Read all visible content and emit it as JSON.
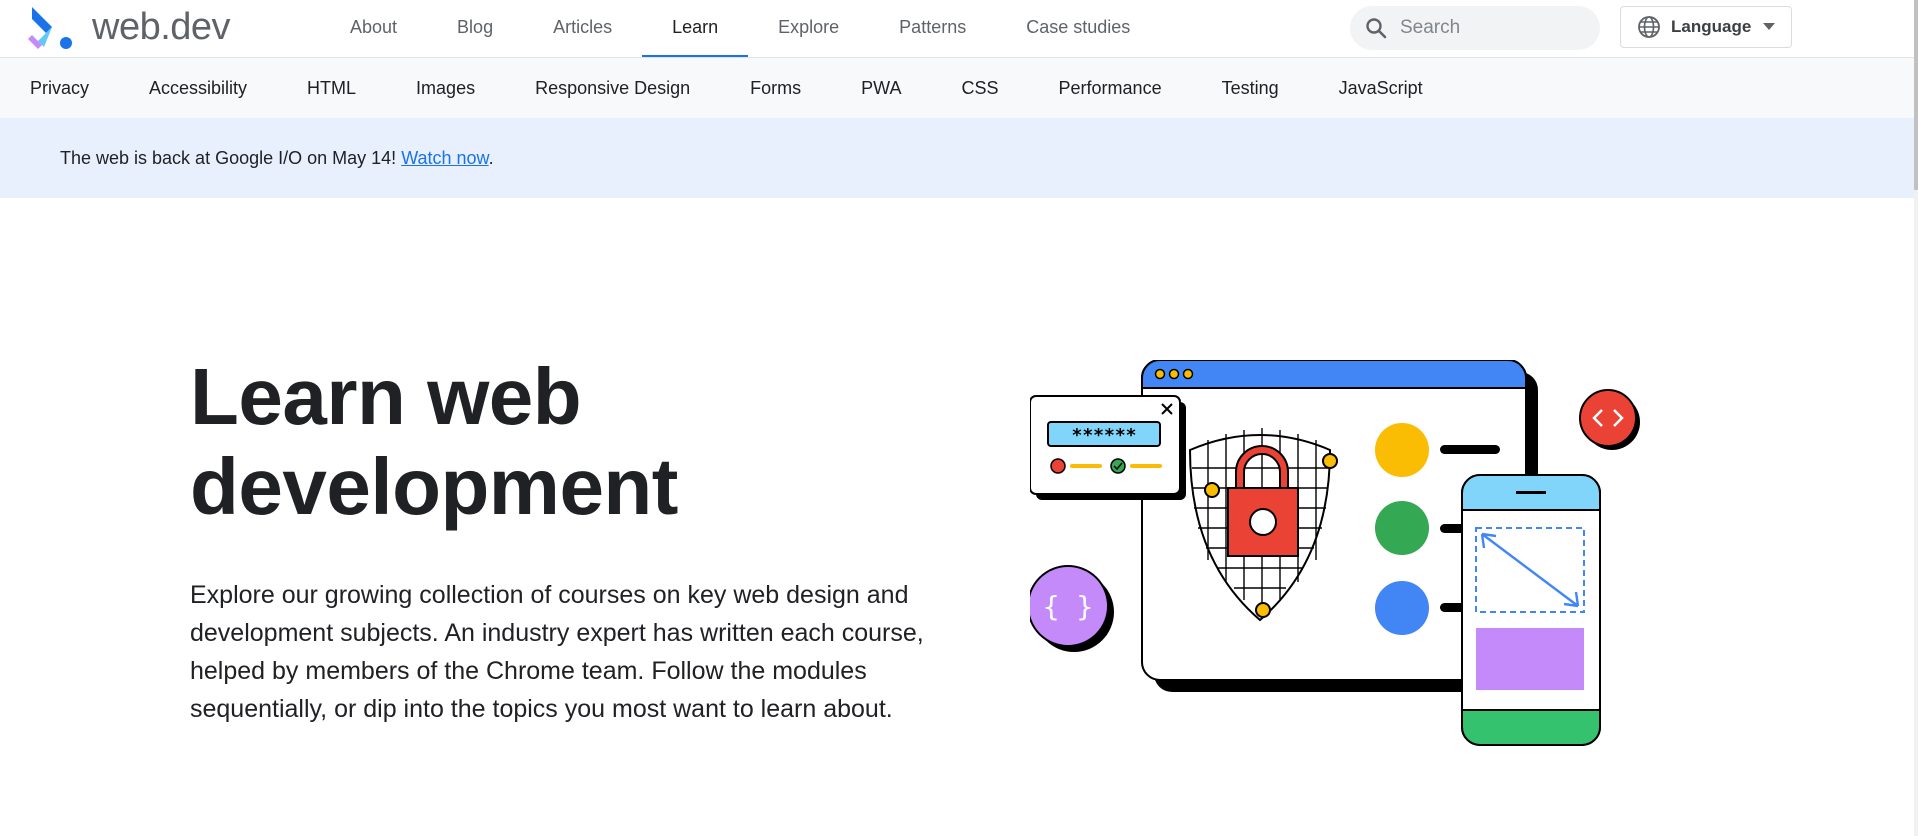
{
  "brand": {
    "name": "web.dev",
    "colors": {
      "blue": "#1a73e8",
      "purple": "#c58af9",
      "cyan": "#4fc3f7"
    }
  },
  "topnav": {
    "tabs": [
      {
        "label": "About"
      },
      {
        "label": "Blog"
      },
      {
        "label": "Articles"
      },
      {
        "label": "Learn",
        "active": true
      },
      {
        "label": "Explore"
      },
      {
        "label": "Patterns"
      },
      {
        "label": "Case studies"
      }
    ]
  },
  "search": {
    "placeholder": "Search",
    "icon": "search-icon"
  },
  "language": {
    "label": "Language",
    "icon": "globe-icon"
  },
  "subnav": {
    "items": [
      {
        "label": "Privacy"
      },
      {
        "label": "Accessibility"
      },
      {
        "label": "HTML"
      },
      {
        "label": "Images"
      },
      {
        "label": "Responsive Design"
      },
      {
        "label": "Forms"
      },
      {
        "label": "PWA"
      },
      {
        "label": "CSS"
      },
      {
        "label": "Performance"
      },
      {
        "label": "Testing"
      },
      {
        "label": "JavaScript"
      }
    ]
  },
  "banner": {
    "text": "The web is back at Google I/O on May 14! ",
    "link": "Watch now",
    "suffix": "."
  },
  "hero": {
    "title_line1": "Learn web",
    "title_line2": "development",
    "description": "Explore our growing collection of courses on key web design and development subjects. An industry expert has written each course, helped by members of the Chrome team. Follow the modules sequentially, or dip into the topics you most want to learn about."
  },
  "illustration": {
    "password_mask": "******",
    "colors": {
      "browser_bar": "#4285f4",
      "lock": "#ea4335",
      "yellow": "#fbbc04",
      "green": "#34a853",
      "blue": "#4285f4",
      "purple": "#c58af9",
      "phone_top": "#81d4fa",
      "phone_bottom": "#34c26f"
    }
  }
}
